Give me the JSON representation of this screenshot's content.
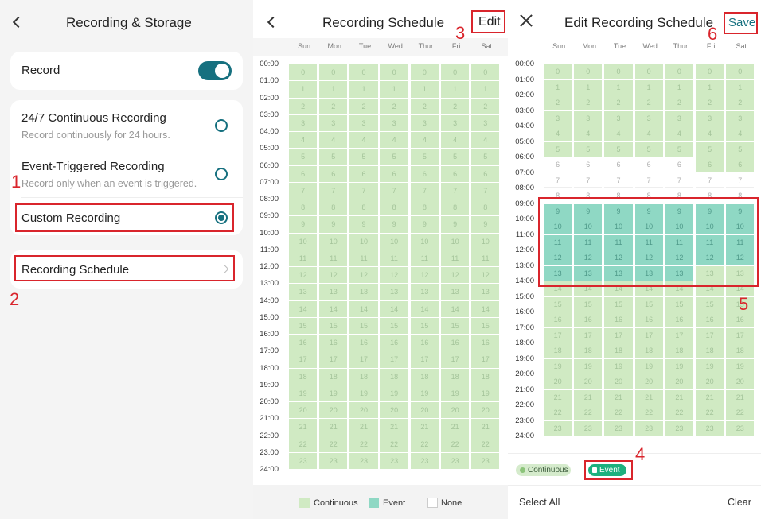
{
  "colors": {
    "accent": "#16707f",
    "continuous": "#d0eac3",
    "event": "#8fd8c4",
    "annotation": "#d9252c"
  },
  "screen1": {
    "title": "Recording & Storage",
    "record_label": "Record",
    "record_enabled": true,
    "options": [
      {
        "title": "24/7 Continuous Recording",
        "sub": "Record continuously for 24 hours.",
        "selected": false
      },
      {
        "title": "Event-Triggered Recording",
        "sub": "Record only when an event is triggered.",
        "selected": false
      },
      {
        "title": "Custom Recording",
        "sub": "",
        "selected": true
      }
    ],
    "schedule_label": "Recording Schedule"
  },
  "screen2": {
    "title": "Recording Schedule",
    "edit_label": "Edit",
    "legend": {
      "continuous": "Continuous",
      "event": "Event",
      "none": "None"
    }
  },
  "screen3": {
    "title": "Edit Recording Schedule",
    "save_label": "Save",
    "pills": {
      "continuous": "Continuous",
      "event": "Event"
    },
    "select_all": "Select All",
    "clear": "Clear"
  },
  "days": [
    "Sun",
    "Mon",
    "Tue",
    "Wed",
    "Thur",
    "Fri",
    "Sat"
  ],
  "times": [
    "00:00",
    "01:00",
    "02:00",
    "03:00",
    "04:00",
    "05:00",
    "06:00",
    "07:00",
    "08:00",
    "09:00",
    "10:00",
    "11:00",
    "12:00",
    "13:00",
    "14:00",
    "15:00",
    "16:00",
    "17:00",
    "18:00",
    "19:00",
    "20:00",
    "21:00",
    "22:00",
    "23:00",
    "24:00"
  ],
  "schedule_view": {
    "hours_recorded": "0-23",
    "mode": "continuous",
    "days": "all"
  },
  "schedule_edit": {
    "continuous_hours": {
      "Sun": "0-5,9-23",
      "Mon": "0-5,9-23",
      "Tue": "0-5,9-23",
      "Wed": "0-5,9-23",
      "Thur": "0-5,9-23",
      "Fri": "0-6,9-23",
      "Sat": "0-6,9-23"
    },
    "event_hours": {
      "Sun": "9-13",
      "Mon": "9-13",
      "Tue": "9-13",
      "Wed": "9-13",
      "Thur": "9-13",
      "Fri": "9-12",
      "Sat": "9-12"
    }
  },
  "annotations": [
    "1",
    "2",
    "3",
    "4",
    "5",
    "6"
  ]
}
